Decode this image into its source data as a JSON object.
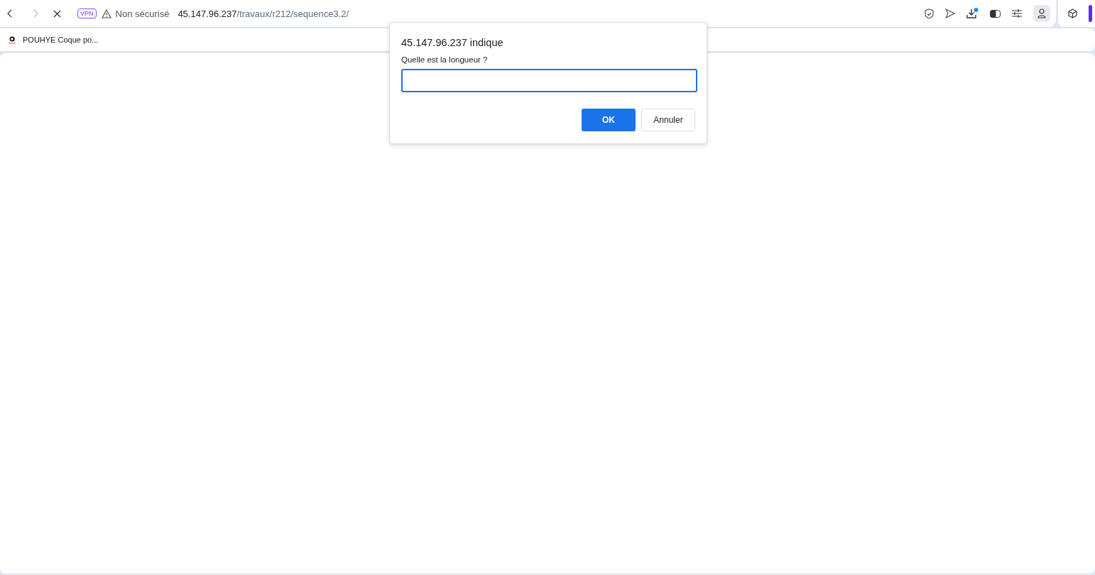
{
  "toolbar": {
    "vpn_badge": "VPN",
    "security": "Non sécurisé",
    "url_host": "45.147.96.237",
    "url_path": "/travaux/r212/sequence3.2/",
    "download_notification": true
  },
  "bookmarks": [
    {
      "label": "POUHYE Coque po..."
    }
  ],
  "dialog": {
    "title": "45.147.96.237 indique",
    "message": "Quelle est la longueur ?",
    "buttons": [
      {
        "label": "OK",
        "kind": "primary"
      },
      {
        "label": "Annuler",
        "kind": "secondary"
      }
    ]
  }
}
